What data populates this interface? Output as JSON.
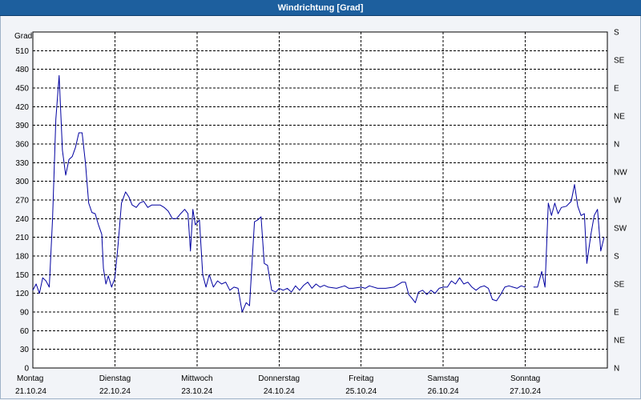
{
  "window": {
    "title": "Windrichtung [Grad]"
  },
  "chart_data": {
    "type": "line",
    "title": "Windrichtung [Grad]",
    "ylabel": "Grad",
    "ylim": [
      0,
      540
    ],
    "yticks": [
      0,
      30,
      60,
      90,
      120,
      150,
      180,
      210,
      240,
      270,
      300,
      330,
      360,
      390,
      420,
      450,
      480,
      510
    ],
    "right_axis_labels": [
      "N",
      "NE",
      "E",
      "SE",
      "S",
      "SW",
      "W",
      "NW",
      "N",
      "NE",
      "E",
      "SE",
      "S"
    ],
    "right_axis_values": [
      0,
      45,
      90,
      135,
      180,
      225,
      270,
      315,
      360,
      405,
      450,
      495,
      540
    ],
    "xlim": [
      0,
      7
    ],
    "grid": true,
    "line_color": "#0000a0",
    "days": [
      {
        "name": "Montag",
        "date": "21.10.24"
      },
      {
        "name": "Dienstag",
        "date": "22.10.24"
      },
      {
        "name": "Mittwoch",
        "date": "23.10.24"
      },
      {
        "name": "Donnerstag",
        "date": "24.10.24"
      },
      {
        "name": "Freitag",
        "date": "25.10.24"
      },
      {
        "name": "Samstag",
        "date": "26.10.24"
      },
      {
        "name": "Sonntag",
        "date": "27.10.24"
      }
    ],
    "segments": [
      [
        [
          0.0,
          125
        ],
        [
          0.04,
          135
        ],
        [
          0.08,
          120
        ],
        [
          0.12,
          145
        ],
        [
          0.16,
          140
        ],
        [
          0.2,
          130
        ],
        [
          0.24,
          240
        ],
        [
          0.28,
          400
        ],
        [
          0.32,
          470
        ],
        [
          0.36,
          350
        ],
        [
          0.4,
          310
        ],
        [
          0.44,
          335
        ],
        [
          0.48,
          340
        ],
        [
          0.52,
          355
        ],
        [
          0.56,
          378
        ],
        [
          0.6,
          378
        ],
        [
          0.64,
          330
        ],
        [
          0.68,
          265
        ],
        [
          0.72,
          250
        ],
        [
          0.76,
          248
        ],
        [
          0.8,
          230
        ],
        [
          0.84,
          215
        ],
        [
          0.86,
          160
        ],
        [
          0.89,
          135
        ],
        [
          0.92,
          148
        ],
        [
          0.96,
          130
        ],
        [
          1.0,
          145
        ],
        [
          1.04,
          200
        ],
        [
          1.08,
          265
        ],
        [
          1.13,
          283
        ],
        [
          1.17,
          275
        ],
        [
          1.21,
          262
        ],
        [
          1.26,
          258
        ],
        [
          1.3,
          265
        ],
        [
          1.35,
          268
        ],
        [
          1.4,
          258
        ],
        [
          1.45,
          262
        ],
        [
          1.5,
          262
        ],
        [
          1.55,
          262
        ],
        [
          1.6,
          258
        ],
        [
          1.65,
          252
        ],
        [
          1.7,
          240
        ],
        [
          1.75,
          240
        ],
        [
          1.8,
          248
        ],
        [
          1.85,
          255
        ],
        [
          1.89,
          248
        ],
        [
          1.92,
          188
        ],
        [
          1.95,
          255
        ],
        [
          1.98,
          230
        ],
        [
          2.03,
          238
        ],
        [
          2.07,
          150
        ],
        [
          2.11,
          130
        ],
        [
          2.15,
          150
        ],
        [
          2.2,
          130
        ],
        [
          2.25,
          140
        ],
        [
          2.3,
          135
        ],
        [
          2.35,
          138
        ],
        [
          2.4,
          125
        ],
        [
          2.45,
          130
        ],
        [
          2.5,
          128
        ],
        [
          2.55,
          90
        ],
        [
          2.6,
          105
        ],
        [
          2.64,
          100
        ],
        [
          2.7,
          235
        ],
        [
          2.74,
          238
        ],
        [
          2.78,
          243
        ],
        [
          2.82,
          168
        ],
        [
          2.86,
          165
        ],
        [
          2.91,
          125
        ],
        [
          2.96,
          122
        ],
        [
          3.0,
          128
        ],
        [
          3.05,
          125
        ],
        [
          3.1,
          128
        ],
        [
          3.15,
          122
        ],
        [
          3.2,
          132
        ],
        [
          3.25,
          125
        ],
        [
          3.3,
          133
        ],
        [
          3.35,
          138
        ],
        [
          3.4,
          128
        ],
        [
          3.45,
          135
        ],
        [
          3.5,
          130
        ],
        [
          3.55,
          133
        ],
        [
          3.6,
          130
        ],
        [
          3.7,
          128
        ],
        [
          3.8,
          132
        ],
        [
          3.85,
          128
        ],
        [
          3.9,
          128
        ],
        [
          4.0,
          130
        ],
        [
          4.05,
          128
        ],
        [
          4.1,
          132
        ],
        [
          4.2,
          128
        ],
        [
          4.3,
          128
        ],
        [
          4.4,
          130
        ],
        [
          4.5,
          138
        ],
        [
          4.54,
          138
        ],
        [
          4.58,
          118
        ],
        [
          4.62,
          112
        ],
        [
          4.66,
          105
        ],
        [
          4.7,
          122
        ],
        [
          4.75,
          125
        ],
        [
          4.8,
          118
        ],
        [
          4.85,
          125
        ],
        [
          4.9,
          120
        ],
        [
          4.95,
          128
        ],
        [
          5.0,
          130
        ],
        [
          5.05,
          130
        ],
        [
          5.1,
          140
        ],
        [
          5.15,
          135
        ],
        [
          5.2,
          145
        ],
        [
          5.25,
          135
        ],
        [
          5.3,
          138
        ],
        [
          5.35,
          130
        ],
        [
          5.4,
          125
        ],
        [
          5.45,
          130
        ],
        [
          5.5,
          132
        ],
        [
          5.55,
          128
        ],
        [
          5.6,
          110
        ],
        [
          5.65,
          108
        ],
        [
          5.7,
          118
        ],
        [
          5.75,
          130
        ],
        [
          5.8,
          132
        ],
        [
          5.85,
          130
        ],
        [
          5.9,
          128
        ],
        [
          5.95,
          132
        ],
        [
          6.0,
          130
        ]
      ],
      [
        [
          6.1,
          130
        ],
        [
          6.15,
          130
        ],
        [
          6.2,
          155
        ],
        [
          6.24,
          130
        ],
        [
          6.28,
          265
        ],
        [
          6.32,
          245
        ],
        [
          6.36,
          265
        ],
        [
          6.4,
          248
        ],
        [
          6.44,
          258
        ],
        [
          6.5,
          260
        ],
        [
          6.56,
          268
        ],
        [
          6.6,
          295
        ],
        [
          6.64,
          260
        ],
        [
          6.68,
          245
        ],
        [
          6.72,
          248
        ],
        [
          6.75,
          168
        ],
        [
          6.8,
          215
        ],
        [
          6.84,
          245
        ],
        [
          6.88,
          255
        ],
        [
          6.92,
          188
        ],
        [
          6.96,
          210
        ]
      ]
    ]
  }
}
